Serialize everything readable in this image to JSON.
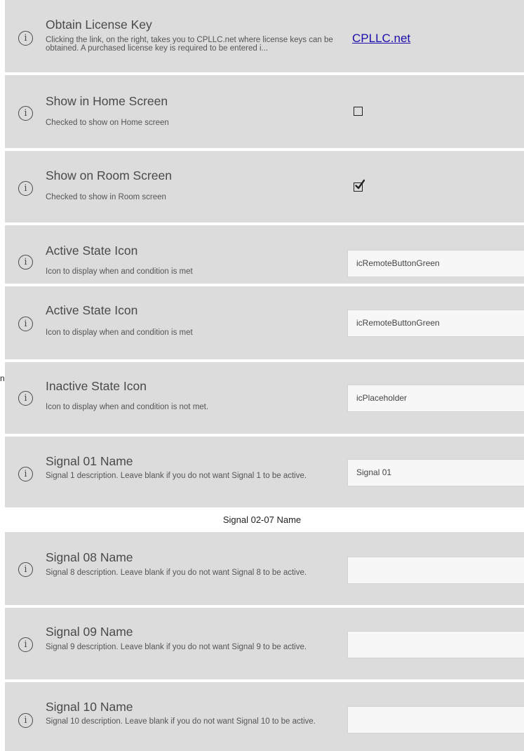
{
  "rows": [
    {
      "title": "Obtain License Key",
      "description": "Clicking the link, on the right, takes you to CPLLC.net where license keys can be obtained.  A purchased license key is required to be entered i...",
      "link_label": "CPLLC.net"
    },
    {
      "title": "Show in Home Screen",
      "description": "Checked to show on Home screen",
      "checked": false
    },
    {
      "title": "Show on Room Screen",
      "description": "Checked to show in Room screen",
      "checked": true
    },
    {
      "title": "Active State Icon",
      "description": "Icon to display when and condition is met",
      "value": "icRemoteButtonGreen"
    },
    {
      "title": "Active State Icon",
      "description": "Icon to display when and condition is met",
      "value": "icRemoteButtonGreen"
    },
    {
      "title": "Inactive State Icon",
      "description": "Icon to display when and condition is not met.",
      "value": "icPlaceholder"
    },
    {
      "title": "Signal 01 Name",
      "description": "Signal 1 description.  Leave blank if you do not want Signal 1 to be active.",
      "value": "Signal 01"
    },
    {
      "title": "Signal 08 Name",
      "description": "Signal 8 description.  Leave blank if you do not want Signal 8 to be active.",
      "value": ""
    },
    {
      "title": "Signal 09 Name",
      "description": "Signal 9 description.  Leave blank if you do not want Signal 9 to be active.",
      "value": ""
    },
    {
      "title": "Signal 10 Name",
      "description": "Signal 10 description.  Leave blank if you do not want Signal 10 to be active.",
      "value": ""
    }
  ],
  "section_label": "Signal 02-07 Name",
  "edge_glyph": "n",
  "icon_names": {
    "info": "info-circle-icon",
    "check": "checkmark-icon"
  }
}
